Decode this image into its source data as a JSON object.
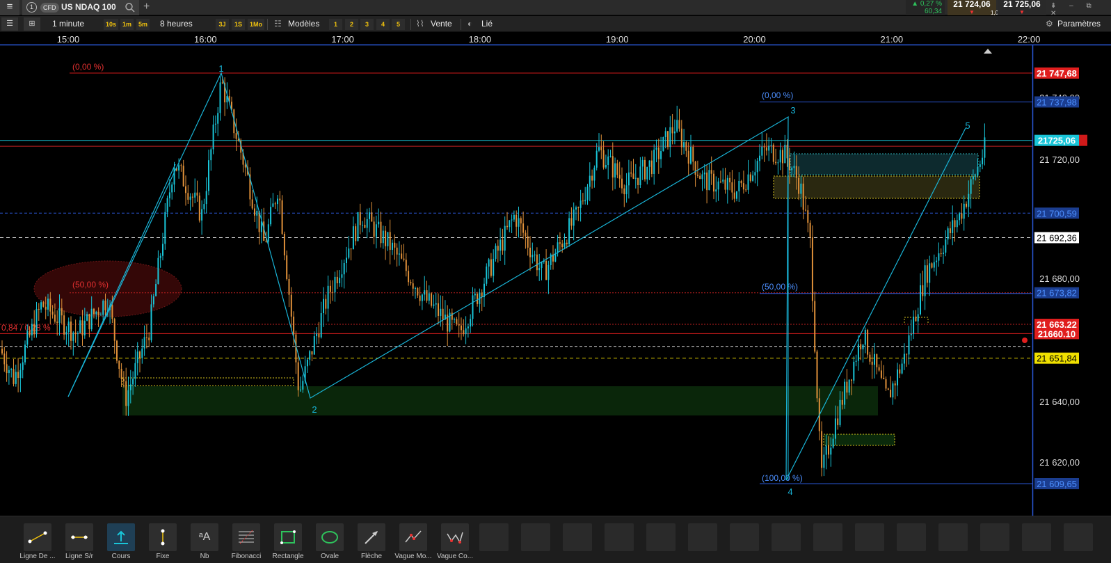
{
  "topbar": {
    "tab_number": "1",
    "instrument_type": "CFD",
    "symbol": "US NDAQ 100",
    "change_pct": "▲ 0,27 %",
    "change_abs": "60,34",
    "bid": "21 724,06",
    "ask": "21 725,06",
    "spread": "1,00",
    "bid_arrow": "▼",
    "ask_arrow": "▼",
    "window_buttons": "⇟ – ⧉ ✕"
  },
  "toolbar": {
    "timeframe": "1 minute",
    "quick_intervals": [
      "10s",
      "1m",
      "5m"
    ],
    "range": "8 heures",
    "quick_ranges": [
      "3J",
      "1S",
      "1Mo"
    ],
    "templates": "Modèles",
    "slots": [
      "1",
      "2",
      "3",
      "4",
      "5"
    ],
    "order": "Vente",
    "linked": "Lié",
    "settings": "Paramètres"
  },
  "chart_data": {
    "type": "candlestick",
    "x_axis_labels": [
      "15:00",
      "16:00",
      "17:00",
      "18:00",
      "19:00",
      "20:00",
      "21:00",
      "22:00"
    ],
    "y_axis_labels": [
      "21 720,00",
      "21 680,00",
      "21 640,00",
      "21 620,00"
    ],
    "ylim": [
      21602,
      21758
    ],
    "price_tags": [
      {
        "text": "21 747,68",
        "value": 21747.68,
        "bg": "#e01e1e",
        "fg": "#ffffff"
      },
      {
        "text": "21 737,98",
        "value": 21737.98,
        "bg": "#1b3d8f",
        "fg": "#4c8fff"
      },
      {
        "text": "21725,06",
        "value": 21725.06,
        "bg": "#19c5d8",
        "fg": "#ffffff"
      },
      {
        "text": "21 700,59",
        "value": 21700.59,
        "bg": "#1b3d8f",
        "fg": "#4c8fff"
      },
      {
        "text": "21 692,36",
        "value": 21692.36,
        "bg": "#ffffff",
        "fg": "#000000"
      },
      {
        "text": "21 673,82",
        "value": 21673.82,
        "bg": "#1b3d8f",
        "fg": "#4c8fff"
      },
      {
        "text": "21 663,22",
        "value": 21663.22,
        "bg": "#e01e1e",
        "fg": "#ffffff"
      },
      {
        "text": "21660.10",
        "value": 21660.1,
        "bg": "#e01e1e",
        "fg": "#ffffff"
      },
      {
        "text": "21 651,84",
        "value": 21651.84,
        "bg": "#f0e000",
        "fg": "#000000"
      },
      {
        "text": "21 609,65",
        "value": 21609.65,
        "bg": "#1b3d8f",
        "fg": "#4c8fff"
      }
    ],
    "fib_red_labels": [
      "(0,00 %)",
      "(50,00 %)"
    ],
    "fib_blue_labels": [
      "(0,00 %)",
      "(50,00 %)",
      "(100,00 %)"
    ],
    "wave_labels": [
      "1",
      "2",
      "3",
      "4",
      "5"
    ],
    "position_label": "0,84 / 0,28 %",
    "candles_description_open": 21655,
    "candles_description_close": 21725.06
  },
  "tools": [
    {
      "label": "Ligne De ...",
      "icon": "trendline-icon"
    },
    {
      "label": "Ligne S/r",
      "icon": "sr-line-icon"
    },
    {
      "label": "Cours",
      "icon": "price-icon"
    },
    {
      "label": "Fixe",
      "icon": "fixed-line-icon"
    },
    {
      "label": "Nb",
      "icon": "text-icon"
    },
    {
      "label": "Fibonacci",
      "icon": "fibonacci-icon"
    },
    {
      "label": "Rectangle",
      "icon": "rectangle-icon"
    },
    {
      "label": "Ovale",
      "icon": "oval-icon"
    },
    {
      "label": "Flèche",
      "icon": "arrow-icon"
    },
    {
      "label": "Vague Mo...",
      "icon": "wave-motive-icon"
    },
    {
      "label": "Vague Co...",
      "icon": "wave-corrective-icon"
    }
  ]
}
